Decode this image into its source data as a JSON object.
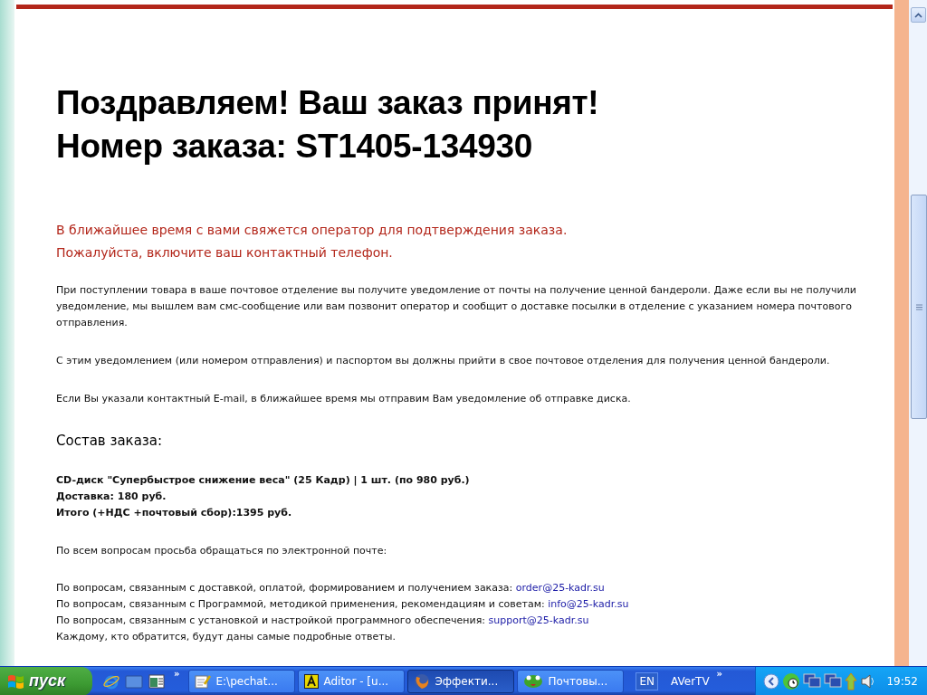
{
  "page": {
    "headline": [
      "Поздравляем! Ваш заказ принят!",
      "Номер заказа: ST1405-134930"
    ],
    "notice": [
      "В ближайшее время с вами свяжется оператор для подтверждения заказа.",
      "Пожалуйста, включите ваш контактный телефон."
    ],
    "paragraphs": [
      "При поступлении товара в ваше почтовое отделение вы получите уведомление от почты на получение ценной бандероли. Даже если вы не получили уведомление, мы вышлем вам смс-сообщение или вам позвонит оператор и сообщит о доставке посылки в отделение с указанием номера почтового отправления.",
      "С этим уведомлением (или номером отправления) и паспортом вы должны прийти в свое почтовое отделения для получения ценной бандероли.",
      "Если Вы указали контактный E-mail, в ближайшее время мы отправим Вам уведомление об отправке диска."
    ],
    "order_heading": "Состав заказа:",
    "order_lines": [
      "CD-диск \"Супербыстрое снижение веса\" (25 Кадр) | 1 шт. (по 980 руб.)",
      "Доставка: 180 руб.",
      "Итого (+НДС +почтовый сбор):1395 руб."
    ],
    "contact_intro": "По всем вопросам просьба обращаться по электронной почте:",
    "contacts": [
      {
        "text": "По вопросам, связанным с доставкой, оплатой, формированием и получением заказа:",
        "email": "order@25-kadr.su"
      },
      {
        "text": "По вопросам, связанным с Программой, методикой применения, рекомендациям и советам:",
        "email": "info@25-kadr.su"
      },
      {
        "text": "По вопросам, связанным с установкой и настройкой программного обеспечения:",
        "email": "support@25-kadr.su"
      }
    ],
    "closing": "Каждому, кто обратится, будут даны самые подробные ответы."
  },
  "taskbar": {
    "start": "пуск",
    "more": "»",
    "tasks": [
      {
        "label": "E:\\pechat...",
        "kind": "notepad",
        "selected": false
      },
      {
        "label": "Aditor - [u...",
        "kind": "aditor",
        "selected": false
      },
      {
        "label": "Эффекти...",
        "kind": "firefox",
        "selected": true
      },
      {
        "label": "Почтовы...",
        "kind": "frog",
        "selected": false
      }
    ],
    "language": "EN",
    "toolbar": "AVerTV",
    "toolbar_more": "»",
    "clock": "19:52"
  }
}
